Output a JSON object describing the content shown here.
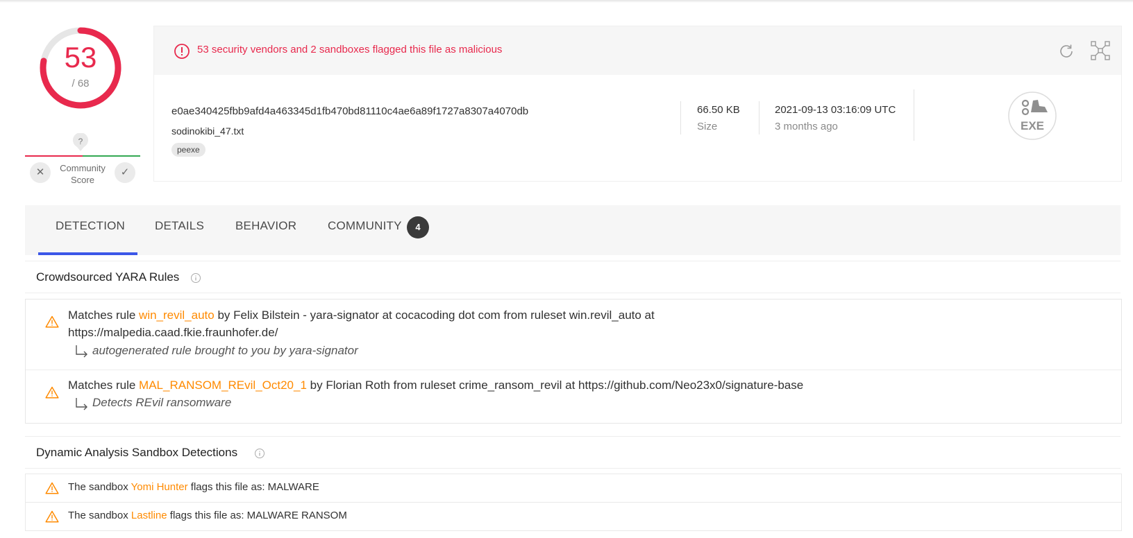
{
  "score": {
    "detections": "53",
    "total": "/ 68",
    "ring_color": "#e8294d",
    "detection_fraction": 0.78,
    "community_label": "Community Score",
    "unknown_symbol": "?"
  },
  "alert": {
    "text": "53 security vendors and 2 sandboxes flagged this file as malicious",
    "icon": "alert-circle-icon",
    "color": "#e8294d"
  },
  "file": {
    "hash": "e0ae340425fbb9afd4a463345d1fb470bd81110c4ae6a89f1727a8307a4070db",
    "name": "sodinokibi_47.txt",
    "tag": "peexe",
    "size_value": "66.50 KB",
    "size_label": "Size",
    "date_value": "2021-09-13 03:16:09 UTC",
    "date_relative": "3 months ago",
    "type_label": "EXE"
  },
  "tabs": [
    {
      "label": "DETECTION",
      "active": true
    },
    {
      "label": "DETAILS"
    },
    {
      "label": "BEHAVIOR"
    },
    {
      "label": "COMMUNITY",
      "badge": "4"
    }
  ],
  "yara": {
    "title": "Crowdsourced YARA Rules",
    "rules": [
      {
        "prefix": "Matches rule ",
        "rule": "win_revil_auto",
        "suffix_line1": " by Felix Bilstein - yara-signator at cocacoding dot com from ruleset win.revil_auto at",
        "suffix_line2": "https://malpedia.caad.fkie.fraunhofer.de/",
        "description": "autogenerated rule brought to you by yara-signator"
      },
      {
        "prefix": "Matches rule ",
        "rule": "MAL_RANSOM_REvil_Oct20_1",
        "suffix_line1": " by Florian Roth from ruleset crime_ransom_revil at https://github.com/Neo23x0/signature-base",
        "description": "Detects REvil ransomware"
      }
    ]
  },
  "sandbox": {
    "title": "Dynamic Analysis Sandbox Detections",
    "rows": [
      {
        "prefix": "The sandbox ",
        "name": "Yomi Hunter",
        "suffix": " flags this file as: MALWARE"
      },
      {
        "prefix": "The sandbox ",
        "name": "Lastline",
        "suffix": " flags this file as: MALWARE RANSOM"
      }
    ]
  },
  "colors": {
    "malicious": "#e8294d",
    "highlight": "#ff8a00",
    "tab_active": "#3c57e8",
    "harmless": "#33a852"
  }
}
